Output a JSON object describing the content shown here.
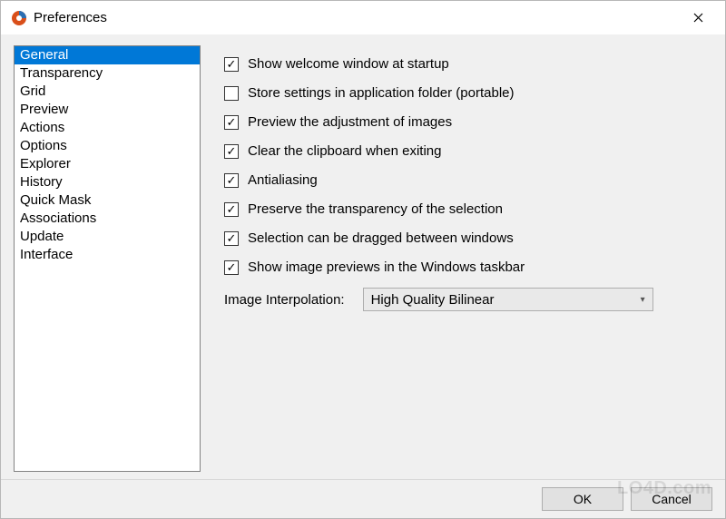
{
  "window": {
    "title": "Preferences",
    "icon": "app-swirl-icon"
  },
  "categories": [
    {
      "label": "General",
      "selected": true
    },
    {
      "label": "Transparency",
      "selected": false
    },
    {
      "label": "Grid",
      "selected": false
    },
    {
      "label": "Preview",
      "selected": false
    },
    {
      "label": "Actions",
      "selected": false
    },
    {
      "label": "Options",
      "selected": false
    },
    {
      "label": "Explorer",
      "selected": false
    },
    {
      "label": "History",
      "selected": false
    },
    {
      "label": "Quick Mask",
      "selected": false
    },
    {
      "label": "Associations",
      "selected": false
    },
    {
      "label": "Update",
      "selected": false
    },
    {
      "label": "Interface",
      "selected": false
    }
  ],
  "options": [
    {
      "label": "Show welcome window at startup",
      "checked": true
    },
    {
      "label": "Store settings in application folder (portable)",
      "checked": false
    },
    {
      "label": "Preview the adjustment of images",
      "checked": true
    },
    {
      "label": "Clear the clipboard when exiting",
      "checked": true
    },
    {
      "label": "Antialiasing",
      "checked": true
    },
    {
      "label": "Preserve the transparency of the selection",
      "checked": true
    },
    {
      "label": "Selection can be dragged between windows",
      "checked": true
    },
    {
      "label": "Show image previews in the Windows taskbar",
      "checked": true
    }
  ],
  "interpolation": {
    "label": "Image Interpolation:",
    "value": "High Quality Bilinear"
  },
  "buttons": {
    "ok": "OK",
    "cancel": "Cancel"
  },
  "watermark": "LO4D.com"
}
